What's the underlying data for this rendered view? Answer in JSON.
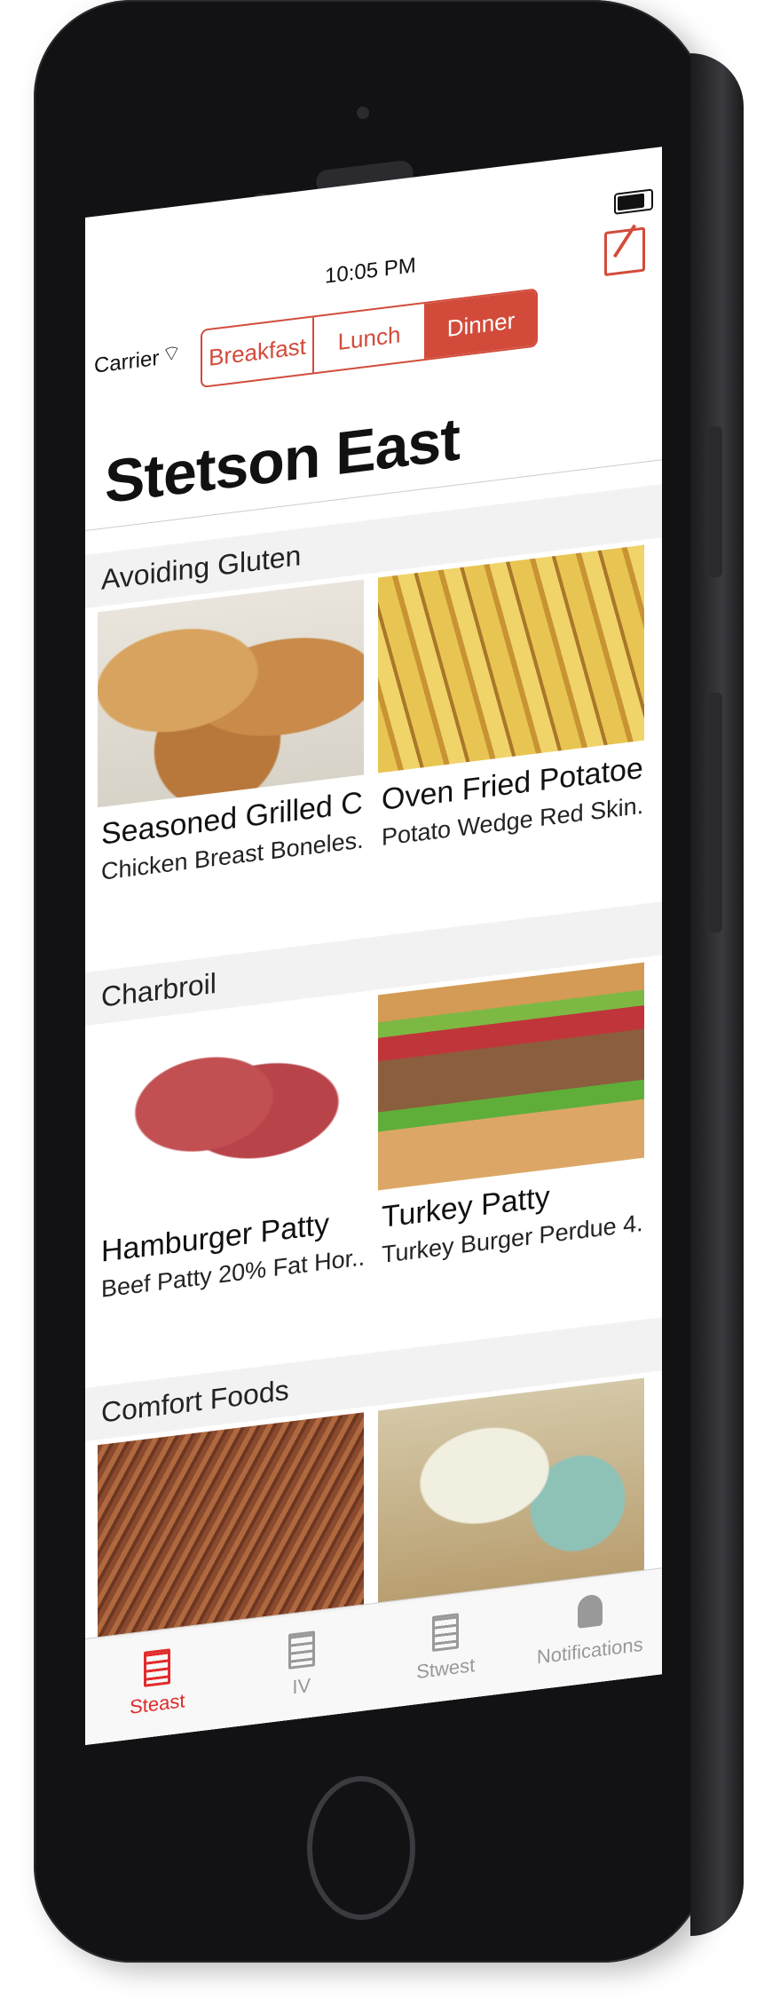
{
  "status_bar": {
    "carrier": "Carrier",
    "time": "10:05 PM"
  },
  "meal_selector": {
    "segments": [
      "Breakfast",
      "Lunch",
      "Dinner"
    ],
    "selected": "Dinner"
  },
  "header": {
    "title": "Stetson East"
  },
  "sections": [
    {
      "title": "Avoiding Gluten",
      "items": [
        {
          "name": "Seasoned Grilled C...",
          "description": "Chicken Breast Boneles...",
          "image": "chicken"
        },
        {
          "name": "Oven Fried Potatoes",
          "description": "Potato Wedge Red Skin...",
          "image": "potatoes"
        }
      ]
    },
    {
      "title": "Charbroil",
      "items": [
        {
          "name": "Hamburger Patty",
          "description": "Beef Patty 20% Fat Hor...",
          "image": "patty"
        },
        {
          "name": "Turkey Patty",
          "description": "Turkey Burger Perdue 4...",
          "image": "burger"
        }
      ]
    },
    {
      "title": "Comfort Foods",
      "items": [
        {
          "name": "",
          "description": "",
          "image": "pork"
        },
        {
          "name": "",
          "description": "",
          "image": "enchilada"
        }
      ]
    }
  ],
  "tab_bar": {
    "tabs": [
      {
        "label": "Steast",
        "icon": "building-icon",
        "active": true
      },
      {
        "label": "IV",
        "icon": "building-icon",
        "active": false
      },
      {
        "label": "Stwest",
        "icon": "building-icon",
        "active": false
      },
      {
        "label": "Notifications",
        "icon": "bell-icon",
        "active": false
      }
    ]
  },
  "accent_color": "#d24b3a",
  "tab_active_color": "#e02b2b"
}
